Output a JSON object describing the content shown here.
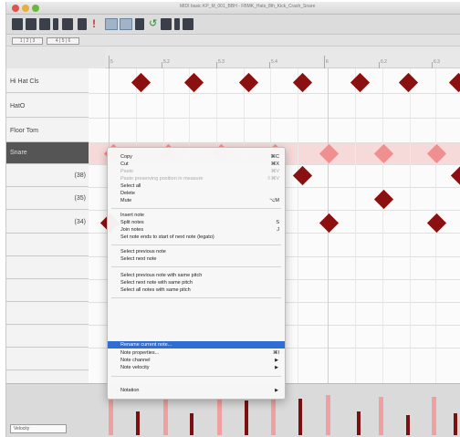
{
  "window": {
    "title": "MIDI basic KP_M_001_BBH - FBMK_Hats_8th_Kick_Crash_Snare"
  },
  "toolbar": {
    "subbar_left": "1 | 2 | 3",
    "subbar_right": "4 | 5 | 6"
  },
  "ruler": {
    "marks": [
      "5",
      "5.2",
      "5.3",
      "5.4",
      "6",
      "6.2",
      "6.3"
    ]
  },
  "keys": [
    {
      "label": "Hi Hat Cls",
      "number": ""
    },
    {
      "label": "HatO",
      "number": ""
    },
    {
      "label": "Floor Tom",
      "number": ""
    },
    {
      "label": "Snare",
      "number": ""
    },
    {
      "label": "",
      "number": "(38)"
    },
    {
      "label": "",
      "number": "(35)"
    },
    {
      "label": "",
      "number": "(34)"
    }
  ],
  "velocity": {
    "selector_label": "Velocity"
  },
  "context_menu": {
    "items": [
      {
        "label": "Copy",
        "shortcut": "⌘C"
      },
      {
        "label": "Cut",
        "shortcut": "⌘X"
      },
      {
        "label": "Paste",
        "shortcut": "⌘V"
      },
      {
        "label": "Paste preserving position in measure",
        "shortcut": "⇧⌘V"
      },
      {
        "label": "Select all",
        "shortcut": ""
      },
      {
        "label": "Delete",
        "shortcut": ""
      },
      {
        "label": "Mute",
        "shortcut": "⌥M"
      },
      {
        "label": "Insert note",
        "shortcut": ""
      },
      {
        "label": "Split notes",
        "shortcut": "S"
      },
      {
        "label": "Join notes",
        "shortcut": "J"
      },
      {
        "label": "Set note ends to start of next note (legato)",
        "shortcut": ""
      },
      {
        "label": "Select previous note",
        "shortcut": ""
      },
      {
        "label": "Select next note",
        "shortcut": ""
      },
      {
        "label": "Select previous note with same pitch",
        "shortcut": ""
      },
      {
        "label": "Select next note with same pitch",
        "shortcut": ""
      },
      {
        "label": "Select all notes with same pitch",
        "shortcut": ""
      },
      {
        "label": "Rename current note...",
        "shortcut": ""
      },
      {
        "label": "Note properties...",
        "shortcut": "⌘I"
      },
      {
        "label": "Note channel",
        "shortcut": ""
      },
      {
        "label": "Note velocity",
        "shortcut": ""
      },
      {
        "label": "Notation",
        "shortcut": ""
      }
    ]
  }
}
